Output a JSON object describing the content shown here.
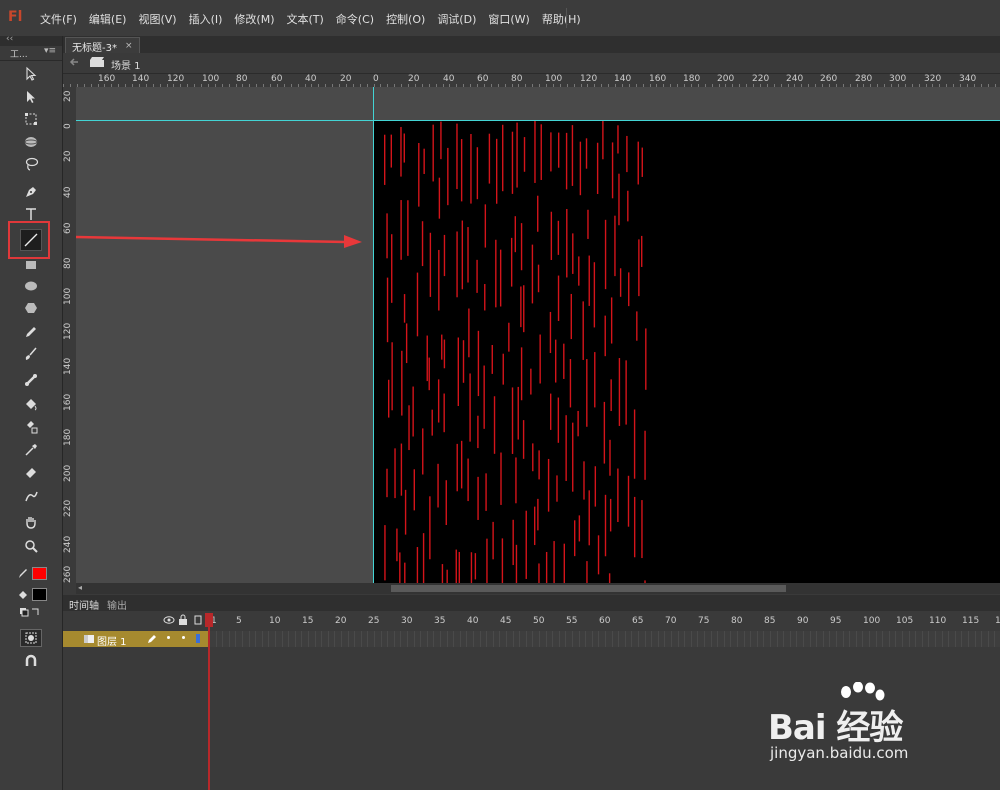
{
  "app": {
    "logo": "Fl"
  },
  "menu": [
    "文件(F)",
    "编辑(E)",
    "视图(V)",
    "插入(I)",
    "修改(M)",
    "文本(T)",
    "命令(C)",
    "控制(O)",
    "调试(D)",
    "窗口(W)",
    "帮助(H)"
  ],
  "tools_panel": {
    "title": "工...",
    "collapse": "‹‹",
    "menu_icon": "▾≡"
  },
  "tools": [
    "selection-arrow-icon",
    "subselection-arrow-icon",
    "free-transform-icon",
    "3d-rotation-icon",
    "lasso-icon",
    "pen-icon",
    "text-icon",
    "line-icon",
    "rectangle-icon",
    "oval-icon",
    "polystar-icon",
    "pencil-icon",
    "brush-icon",
    "bone-icon",
    "paint-bucket-icon",
    "ink-bottle-icon",
    "eyedropper-icon",
    "eraser-icon",
    "deco-icon",
    "hand-icon",
    "zoom-icon"
  ],
  "colors": {
    "stroke": "#ff0000",
    "fill": "#000000",
    "stage": "#000000",
    "guide": "#43d4d4",
    "highlight": "#e0383a",
    "layer": "#a68a2f"
  },
  "document": {
    "tab_label": "无标题-3*",
    "close": "×"
  },
  "scene": {
    "label": "场景 1"
  },
  "ruler_h": [
    "20",
    "160",
    "140",
    "120",
    "100",
    "80",
    "60",
    "40",
    "20",
    "0",
    "20",
    "40",
    "60",
    "80",
    "100",
    "120",
    "140",
    "160",
    "180",
    "200",
    "220",
    "240",
    "260",
    "280",
    "300",
    "320",
    "340"
  ],
  "ruler_v": [
    "20",
    "0",
    "20",
    "40",
    "60",
    "80",
    "100",
    "120",
    "140",
    "160",
    "180",
    "200",
    "220",
    "240",
    "260"
  ],
  "timeline": {
    "tabs": [
      "时间轴",
      "输出"
    ],
    "frame_numbers": [
      "1",
      "5",
      "10",
      "15",
      "20",
      "25",
      "30",
      "35",
      "40",
      "45",
      "50",
      "55",
      "60",
      "65",
      "70",
      "75",
      "80",
      "85",
      "90",
      "95",
      "100",
      "105",
      "110",
      "115",
      "12"
    ],
    "layer": {
      "name": "图层 1"
    }
  },
  "watermark": {
    "brand": "Bai 经验",
    "url": "jingyan.baidu.com"
  }
}
